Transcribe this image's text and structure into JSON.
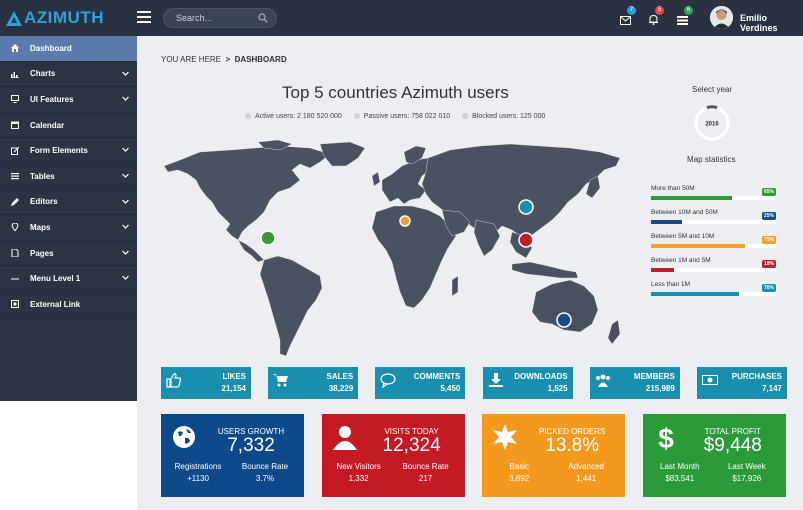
{
  "brand": {
    "name": "AZIMUTH",
    "color": "#2aa3dc"
  },
  "topbar": {
    "search_placeholder": "Search...",
    "notifications": [
      {
        "icon": "mail-icon",
        "count": "7",
        "color": "#2aa3dc"
      },
      {
        "icon": "bell-icon",
        "count": "5",
        "color": "#e04b4b"
      },
      {
        "icon": "list-icon",
        "count": "6",
        "color": "#3aa35b"
      }
    ],
    "user_name": "Emilio Verdines"
  },
  "sidebar": {
    "items": [
      {
        "label": "Dashboard",
        "icon": "home-icon",
        "active": true,
        "has_children": false
      },
      {
        "label": "Charts",
        "icon": "bar-chart-icon",
        "active": false,
        "has_children": true
      },
      {
        "label": "UI Features",
        "icon": "monitor-icon",
        "active": false,
        "has_children": true
      },
      {
        "label": "Calendar",
        "icon": "calendar-icon",
        "active": false,
        "has_children": false
      },
      {
        "label": "Form Elements",
        "icon": "edit-icon",
        "active": false,
        "has_children": true
      },
      {
        "label": "Tables",
        "icon": "table-icon",
        "active": false,
        "has_children": true
      },
      {
        "label": "Editors",
        "icon": "pencil-icon",
        "active": false,
        "has_children": true
      },
      {
        "label": "Maps",
        "icon": "map-pin-icon",
        "active": false,
        "has_children": true
      },
      {
        "label": "Pages",
        "icon": "page-icon",
        "active": false,
        "has_children": true
      },
      {
        "label": "Menu Level 1",
        "icon": "dots-icon",
        "active": false,
        "has_children": true
      },
      {
        "label": "External Link",
        "icon": "external-link-icon",
        "active": false,
        "has_children": false
      }
    ]
  },
  "breadcrumb": {
    "prefix": "YOU ARE HERE",
    "separator": ">",
    "current": "DASHBOARD"
  },
  "map_panel": {
    "title": "Top 5 countries Azimuth users",
    "legend": [
      "Active users: 2 180 520 000",
      "Passive users: 758 022 010",
      "Blocked users: 125 000"
    ],
    "markers": [
      {
        "name": "usa-marker",
        "color": "#3a9a3a"
      },
      {
        "name": "germany-marker",
        "color": "#f0a12b"
      },
      {
        "name": "russia-marker",
        "color": "#1a8ead"
      },
      {
        "name": "china-marker",
        "color": "#c0202b"
      },
      {
        "name": "australia-marker",
        "color": "#1a4c8a"
      }
    ]
  },
  "year_select": {
    "label": "Select year",
    "year": "2016"
  },
  "map_stats": {
    "title": "Map statistics",
    "rows": [
      {
        "label": "More than 50M",
        "percent": 65,
        "pct_label": "65%",
        "color": "#2f9a38"
      },
      {
        "label": "Between 10M and 50M",
        "percent": 25,
        "pct_label": "25%",
        "color": "#1a4c8a"
      },
      {
        "label": "Between 5M and 10M",
        "percent": 75,
        "pct_label": "75%",
        "color": "#f0a12b"
      },
      {
        "label": "Between 1M and 5M",
        "percent": 18,
        "pct_label": "18%",
        "color": "#c0202b"
      },
      {
        "label": "Less than 1M",
        "percent": 70,
        "pct_label": "70%",
        "color": "#1a8ead"
      }
    ]
  },
  "kpis": [
    {
      "label": "LIKES",
      "value": "21,154",
      "icon": "thumbs-up-icon"
    },
    {
      "label": "SALES",
      "value": "38,229",
      "icon": "cart-icon"
    },
    {
      "label": "COMMENTS",
      "value": "5,450",
      "icon": "comment-icon"
    },
    {
      "label": "DOWNLOADS",
      "value": "1,525",
      "icon": "download-icon"
    },
    {
      "label": "MEMBERS",
      "value": "215,989",
      "icon": "users-icon"
    },
    {
      "label": "PURCHASES",
      "value": "7,147",
      "icon": "money-icon"
    }
  ],
  "cards": [
    {
      "title": "USERS GROWTH",
      "value": "7,332",
      "icon": "globe-icon",
      "color": "#0e4a8a",
      "left_label": "Registrations",
      "left_value": "+1130",
      "right_label": "Bounce Rate",
      "right_value": "3.7%"
    },
    {
      "title": "VISITS TODAY",
      "value": "12,324",
      "icon": "user-icon",
      "color": "#c41a25",
      "left_label": "New Visitors",
      "left_value": "1,332",
      "right_label": "Bounce Rate",
      "right_value": "217"
    },
    {
      "title": "PICKED ORDERS",
      "value": "13.8%",
      "icon": "burst-icon",
      "color": "#f39a1e",
      "left_label": "Basic",
      "left_value": "3,692",
      "right_label": "Advanced",
      "right_value": "1,441"
    },
    {
      "title": "TOTAL PROFIT",
      "value": "$9,448",
      "icon": "dollar-icon",
      "color": "#2b9b3a",
      "left_label": "Last Month",
      "left_value": "$83,541",
      "right_label": "Last Week",
      "right_value": "$17,926"
    }
  ]
}
